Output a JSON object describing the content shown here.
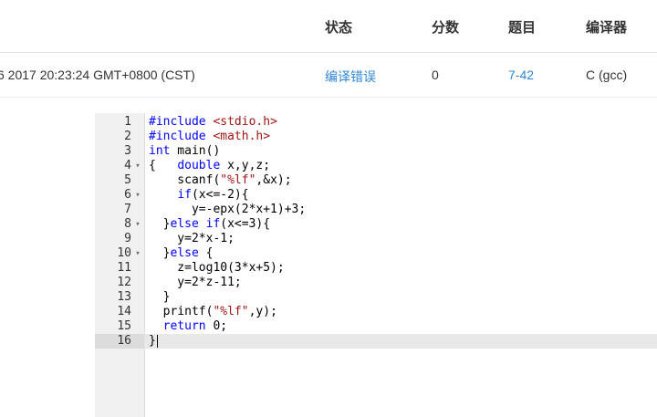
{
  "table": {
    "headers": {
      "status": "状态",
      "score": "分数",
      "problem": "题目",
      "compiler": "编译器"
    },
    "row": {
      "time": "6 2017 20:23:24 GMT+0800 (CST)",
      "status": "编译错误",
      "score": "0",
      "problem": "7-42",
      "compiler": "C (gcc)"
    }
  },
  "editor": {
    "active_line": 16,
    "lines": [
      {
        "n": "1",
        "fold": "",
        "code": "#include <stdio.h>"
      },
      {
        "n": "2",
        "fold": "",
        "code": "#include <math.h>"
      },
      {
        "n": "3",
        "fold": "",
        "code": "int main()"
      },
      {
        "n": "4",
        "fold": "▾",
        "code": "{   double x,y,z;"
      },
      {
        "n": "5",
        "fold": "",
        "code": "    scanf(\"%lf\",&x);"
      },
      {
        "n": "6",
        "fold": "▾",
        "code": "    if(x<=-2){"
      },
      {
        "n": "7",
        "fold": "",
        "code": "      y=-epx(2*x+1)+3;"
      },
      {
        "n": "8",
        "fold": "▾",
        "code": "  }else if(x<=3){"
      },
      {
        "n": "9",
        "fold": "",
        "code": "    y=2*x-1;"
      },
      {
        "n": "10",
        "fold": "▾",
        "code": "  }else {"
      },
      {
        "n": "11",
        "fold": "",
        "code": "    z=log10(3*x+5);"
      },
      {
        "n": "12",
        "fold": "",
        "code": "    y=2*z-11;"
      },
      {
        "n": "13",
        "fold": "",
        "code": "  }"
      },
      {
        "n": "14",
        "fold": "",
        "code": "  printf(\"%lf\",y);"
      },
      {
        "n": "15",
        "fold": "",
        "code": "  return 0;"
      },
      {
        "n": "16",
        "fold": "",
        "code": "}"
      }
    ]
  }
}
